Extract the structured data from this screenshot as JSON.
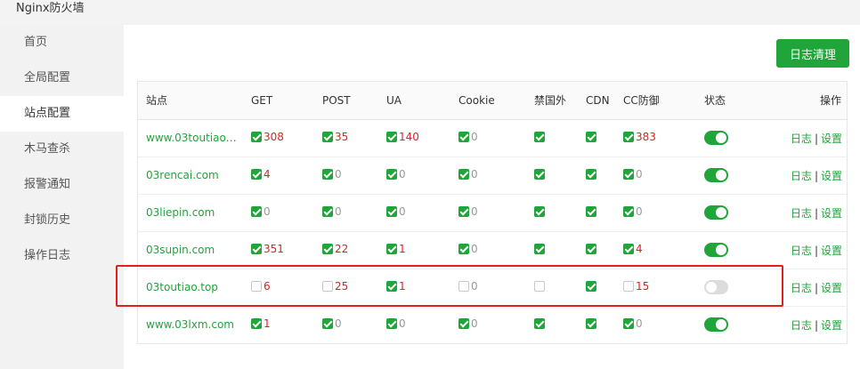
{
  "window": {
    "title": "Nginx防火墙"
  },
  "sidebar": {
    "items": [
      {
        "label": "首页",
        "active": false
      },
      {
        "label": "全局配置",
        "active": false
      },
      {
        "label": "站点配置",
        "active": true
      },
      {
        "label": "木马查杀",
        "active": false
      },
      {
        "label": "报警通知",
        "active": false
      },
      {
        "label": "封锁历史",
        "active": false
      },
      {
        "label": "操作日志",
        "active": false
      }
    ]
  },
  "toolbar": {
    "clear_log_label": "日志清理"
  },
  "table": {
    "headers": {
      "site": "站点",
      "get": "GET",
      "post": "POST",
      "ua": "UA",
      "cookie": "Cookie",
      "ban_foreign": "禁国外",
      "cdn": "CDN",
      "cc": "CC防御",
      "state": "状态",
      "ops": "操作"
    },
    "rows": [
      {
        "site": "www.03toutiao.c…",
        "get": {
          "on": true,
          "count": "308"
        },
        "post": {
          "on": true,
          "count": "35"
        },
        "ua": {
          "on": true,
          "count": "140"
        },
        "cookie": {
          "on": true,
          "count": "0"
        },
        "ban_foreign": true,
        "cdn": true,
        "cc": {
          "on": true,
          "count": "383"
        },
        "state": true,
        "log": "日志",
        "sep": "|",
        "settings": "设置"
      },
      {
        "site": "03rencai.com",
        "get": {
          "on": true,
          "count": "4"
        },
        "post": {
          "on": true,
          "count": "0"
        },
        "ua": {
          "on": true,
          "count": "0"
        },
        "cookie": {
          "on": true,
          "count": "0"
        },
        "ban_foreign": true,
        "cdn": true,
        "cc": {
          "on": true,
          "count": "0"
        },
        "state": true,
        "log": "日志",
        "sep": "|",
        "settings": "设置"
      },
      {
        "site": "03liepin.com",
        "get": {
          "on": true,
          "count": "0"
        },
        "post": {
          "on": true,
          "count": "0"
        },
        "ua": {
          "on": true,
          "count": "0"
        },
        "cookie": {
          "on": true,
          "count": "0"
        },
        "ban_foreign": true,
        "cdn": true,
        "cc": {
          "on": true,
          "count": "0"
        },
        "state": true,
        "log": "日志",
        "sep": "|",
        "settings": "设置"
      },
      {
        "site": "03supin.com",
        "get": {
          "on": true,
          "count": "351"
        },
        "post": {
          "on": true,
          "count": "22"
        },
        "ua": {
          "on": true,
          "count": "1"
        },
        "cookie": {
          "on": true,
          "count": "0"
        },
        "ban_foreign": true,
        "cdn": true,
        "cc": {
          "on": true,
          "count": "4"
        },
        "state": true,
        "log": "日志",
        "sep": "|",
        "settings": "设置"
      },
      {
        "site": "03toutiao.top",
        "get": {
          "on": false,
          "count": "6"
        },
        "post": {
          "on": false,
          "count": "25"
        },
        "ua": {
          "on": true,
          "count": "1"
        },
        "cookie": {
          "on": false,
          "count": "0"
        },
        "ban_foreign": false,
        "cdn": true,
        "cc": {
          "on": false,
          "count": "15"
        },
        "state": false,
        "log": "日志",
        "sep": "|",
        "settings": "设置"
      },
      {
        "site": "www.03lxm.com",
        "get": {
          "on": true,
          "count": "1"
        },
        "post": {
          "on": true,
          "count": "0"
        },
        "ua": {
          "on": true,
          "count": "0"
        },
        "cookie": {
          "on": true,
          "count": "0"
        },
        "ban_foreign": true,
        "cdn": true,
        "cc": {
          "on": true,
          "count": "0"
        },
        "state": true,
        "log": "日志",
        "sep": "|",
        "settings": "设置"
      }
    ]
  },
  "colors": {
    "accent": "#20a53a",
    "count_alert": "#e02020",
    "count_zero": "#999999",
    "highlight_border": "#e02020"
  }
}
